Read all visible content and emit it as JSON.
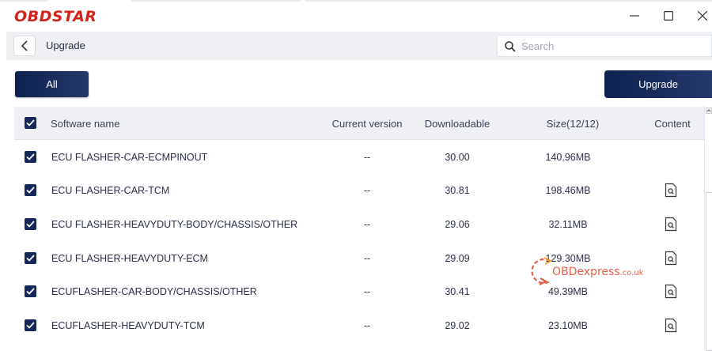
{
  "app": {
    "brand": "OBDSTAR"
  },
  "header": {
    "title": "Upgrade",
    "search_placeholder": "Search"
  },
  "toolbar": {
    "all_label": "All",
    "upgrade_label": "Upgrade"
  },
  "table": {
    "columns": [
      "Software name",
      "Current version",
      "Downloadable",
      "Size(12/12)",
      "Content"
    ],
    "rows": [
      {
        "name": "ECU FLASHER-CAR-ECMPINOUT",
        "current": "--",
        "downloadable": "30.00",
        "size": "140.96MB",
        "content": false
      },
      {
        "name": "ECU FLASHER-CAR-TCM",
        "current": "--",
        "downloadable": "30.81",
        "size": "198.46MB",
        "content": true
      },
      {
        "name": "ECU FLASHER-HEAVYDUTY-BODY/CHASSIS/OTHER",
        "current": "--",
        "downloadable": "29.06",
        "size": "32.11MB",
        "content": true
      },
      {
        "name": "ECU FLASHER-HEAVYDUTY-ECM",
        "current": "--",
        "downloadable": "29.09",
        "size": "129.30MB",
        "content": true
      },
      {
        "name": "ECUFLASHER-CAR-BODY/CHASSIS/OTHER",
        "current": "--",
        "downloadable": "30.41",
        "size": "49.39MB",
        "content": true
      },
      {
        "name": "ECUFLASHER-HEAVYDUTY-TCM",
        "current": "--",
        "downloadable": "29.02",
        "size": "23.10MB",
        "content": true
      }
    ]
  },
  "watermark": {
    "text_main": "OBDexpress",
    "text_suffix": ".co.uk"
  },
  "colors": {
    "brand_red": "#d0231c",
    "accent_navy": "#16285a",
    "watermark": "#e0452a"
  }
}
